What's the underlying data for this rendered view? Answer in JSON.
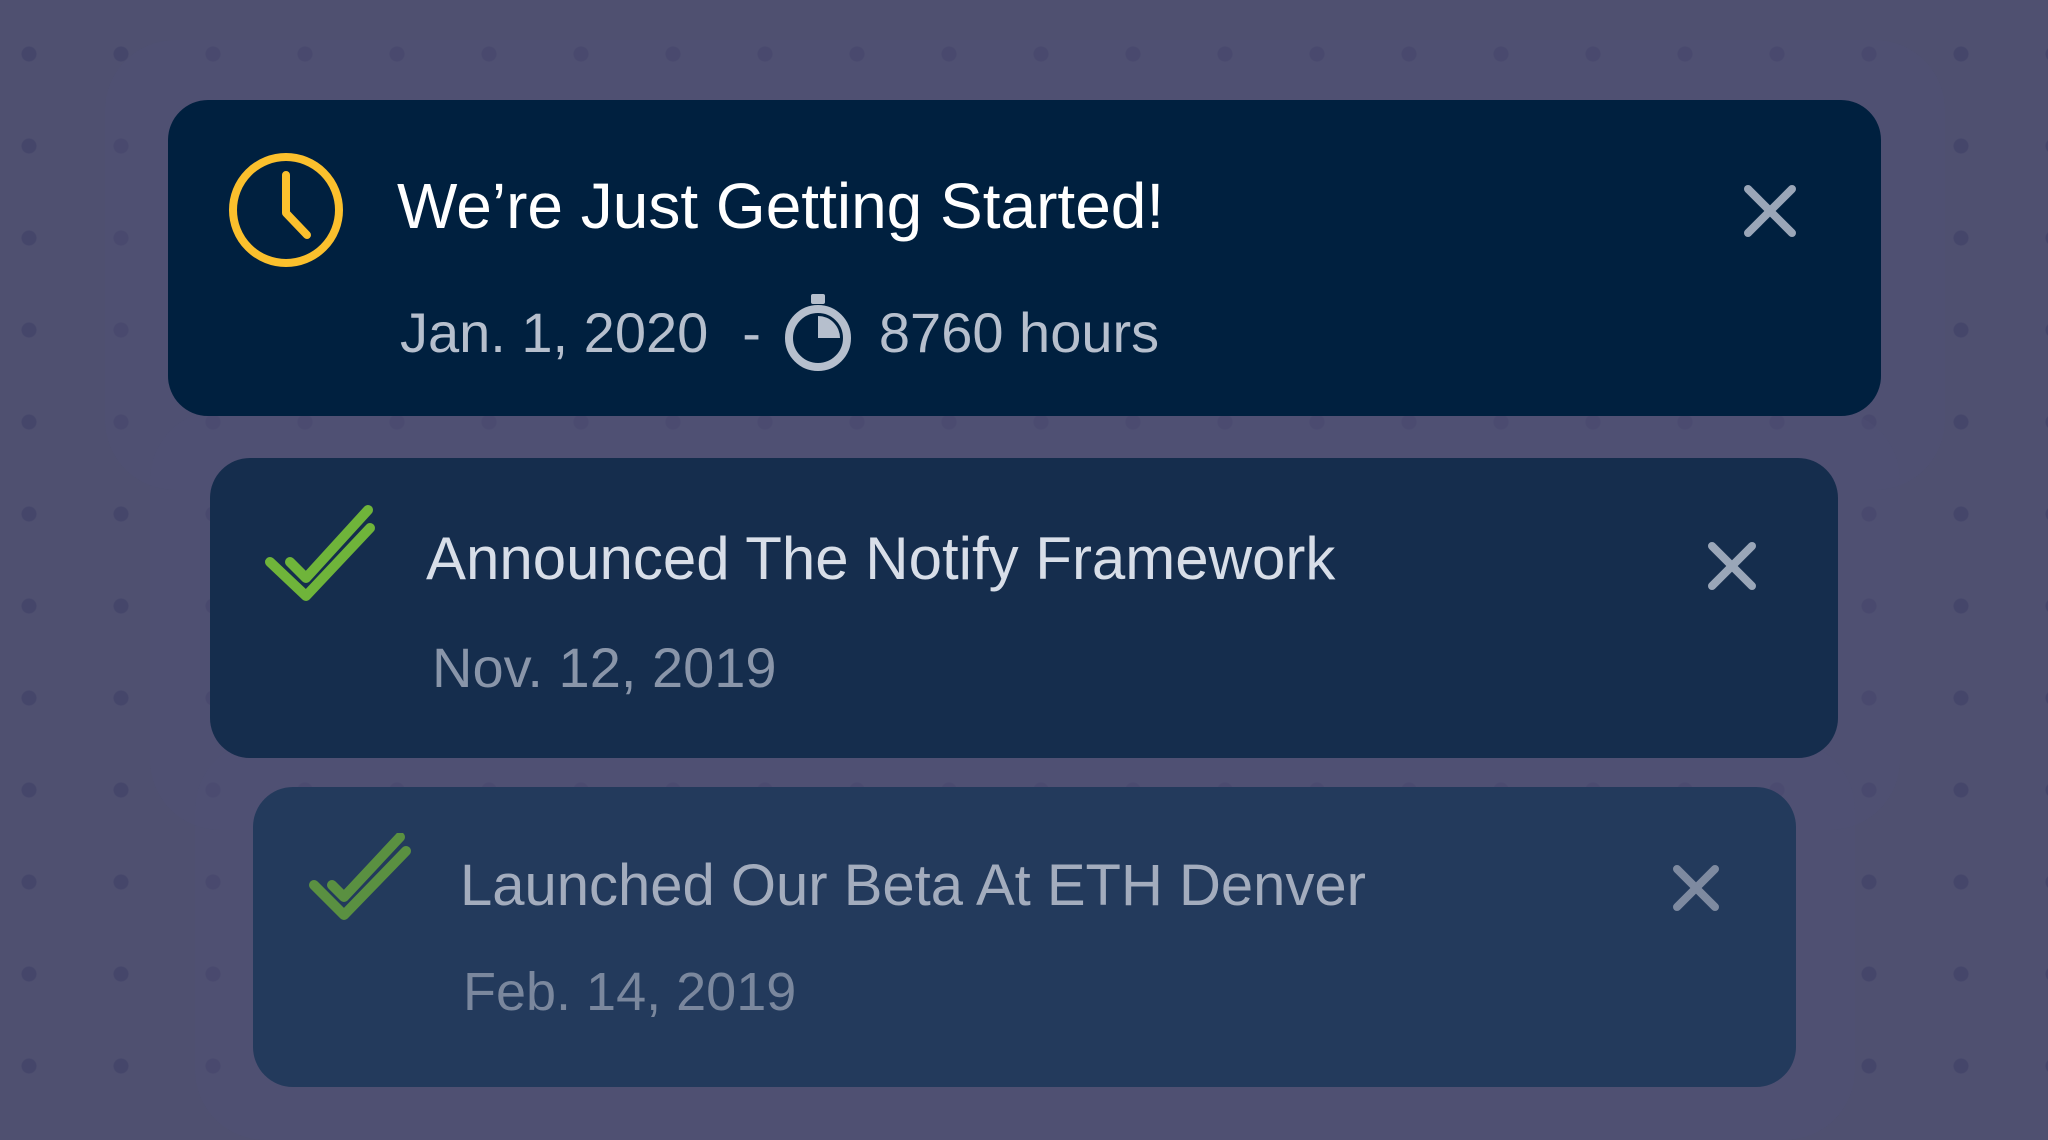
{
  "colors": {
    "background": "#4f5070",
    "card_1_bg": "#00203f",
    "card_2_bg": "#152d4d",
    "card_3_bg": "#233a5c",
    "clock_accent": "#fbc02d",
    "check_accent": "#6fb43a",
    "close_icon": "#9aa6b8"
  },
  "notifications": [
    {
      "title": "We’re Just Getting Started!",
      "date": "Jan. 1, 2020",
      "separator": "-",
      "duration": "8760 hours",
      "status_icon": "clock-icon",
      "duration_icon": "stopwatch-icon",
      "close_icon": "close-icon"
    },
    {
      "title": "Announced The Notify Framework",
      "date": "Nov. 12, 2019",
      "status_icon": "double-check-icon",
      "close_icon": "close-icon"
    },
    {
      "title": "Launched Our Beta At ETH Denver",
      "date": "Feb. 14, 2019",
      "status_icon": "double-check-icon",
      "close_icon": "close-icon"
    }
  ]
}
